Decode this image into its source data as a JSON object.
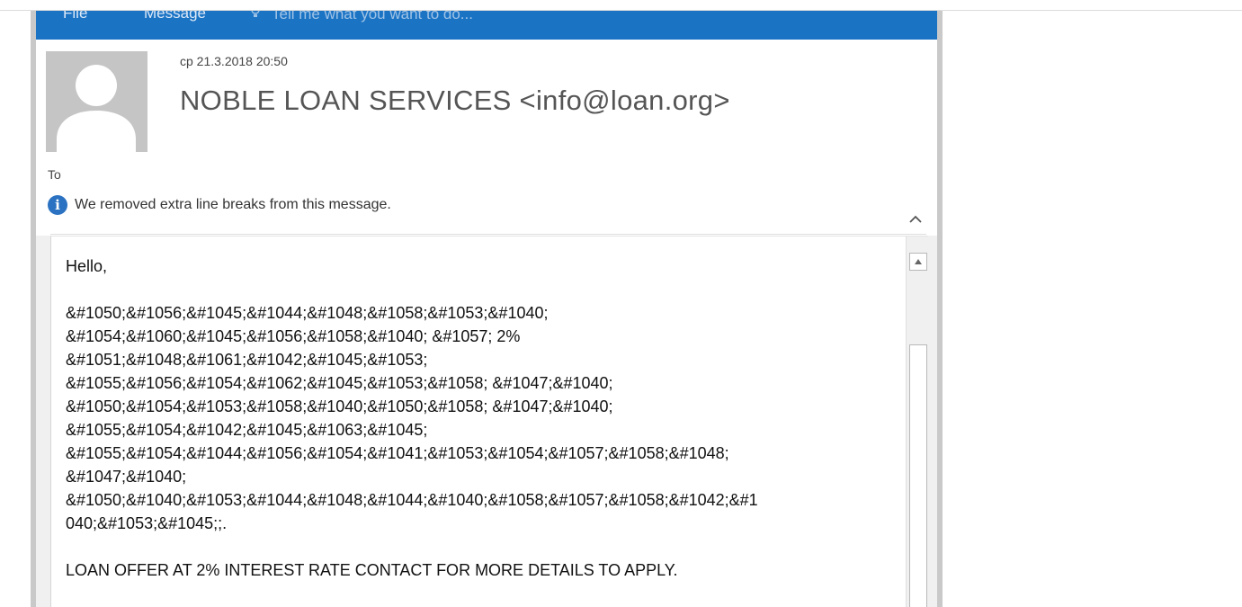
{
  "ribbon": {
    "tabs": [
      "File",
      "Message"
    ],
    "tell_me": "Tell me what you want to do...",
    "background": "#1b73c4"
  },
  "message": {
    "date": "cp 21.3.2018 20:50",
    "sender": "NOBLE LOAN SERVICES <info@loan.org>",
    "to_label": "To",
    "info_icon": "info-icon",
    "info_text": "We removed extra line breaks from this message.",
    "collapse_icon": "chevron-up-icon"
  },
  "body": {
    "greeting": "Hello,",
    "encoded_lines": [
      "&#1050;&#1056;&#1045;&#1044;&#1048;&#1058;&#1053;&#1040;",
      "&#1054;&#1060;&#1045;&#1056;&#1058;&#1040; &#1057; 2%",
      "&#1051;&#1048;&#1061;&#1042;&#1045;&#1053;",
      "&#1055;&#1056;&#1054;&#1062;&#1045;&#1053;&#1058; &#1047;&#1040;",
      "&#1050;&#1054;&#1053;&#1058;&#1040;&#1050;&#1058; &#1047;&#1040;",
      "&#1055;&#1054;&#1042;&#1045;&#1063;&#1045;",
      "&#1055;&#1054;&#1044;&#1056;&#1054;&#1041;&#1053;&#1054;&#1057;&#1058;&#1048;",
      "&#1047;&#1040;",
      "&#1050;&#1040;&#1053;&#1044;&#1048;&#1044;&#1040;&#1058;&#1057;&#1058;&#1042;&#1",
      "040;&#1053;&#1045;;."
    ],
    "offer": "LOAN OFFER AT 2% INTEREST RATE CONTACT FOR MORE DETAILS TO APPLY."
  }
}
